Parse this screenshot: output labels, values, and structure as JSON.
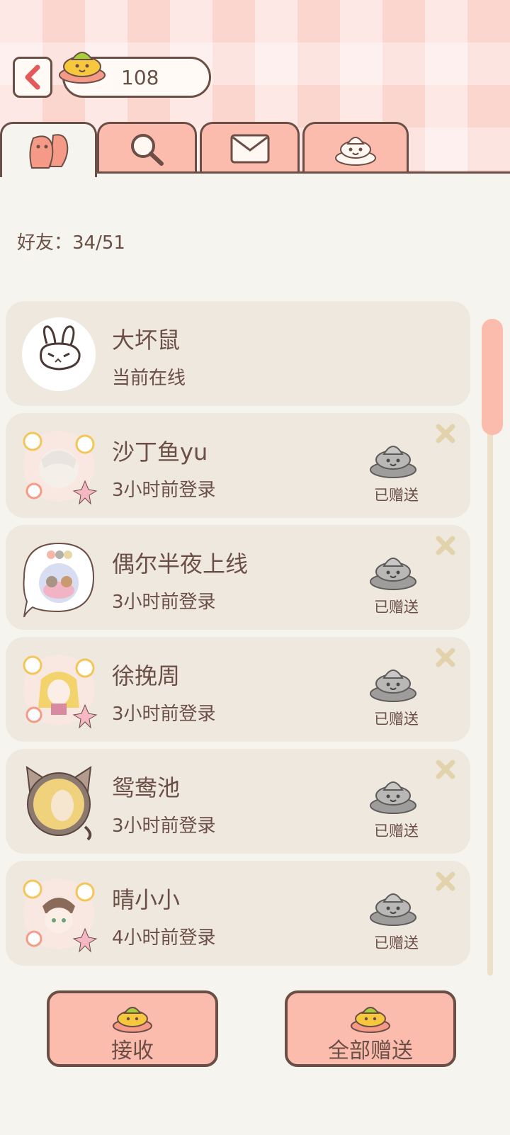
{
  "header": {
    "coin_count": "108"
  },
  "tabs": [
    {
      "icon": "friends-icon"
    },
    {
      "icon": "search-icon"
    },
    {
      "icon": "mail-icon"
    },
    {
      "icon": "poop-icon"
    }
  ],
  "friend_count_label": "好友：34/51",
  "friends": [
    {
      "name": "大坏鼠",
      "status": "当前在线",
      "sent_label": ""
    },
    {
      "name": "沙丁鱼yu",
      "status": "3小时前登录",
      "sent_label": "已赠送"
    },
    {
      "name": "偶尔半夜上线",
      "status": "3小时前登录",
      "sent_label": "已赠送"
    },
    {
      "name": "徐挽周",
      "status": "3小时前登录",
      "sent_label": "已赠送"
    },
    {
      "name": "鸳鸯池",
      "status": "3小时前登录",
      "sent_label": "已赠送"
    },
    {
      "name": "晴小小",
      "status": "4小时前登录",
      "sent_label": "已赠送"
    }
  ],
  "buttons": {
    "receive": "接收",
    "send_all": "全部赠送"
  },
  "colors": {
    "accent_pink": "#fbbcad",
    "outline_brown": "#6b4f46",
    "card_bg": "#efe8de"
  }
}
